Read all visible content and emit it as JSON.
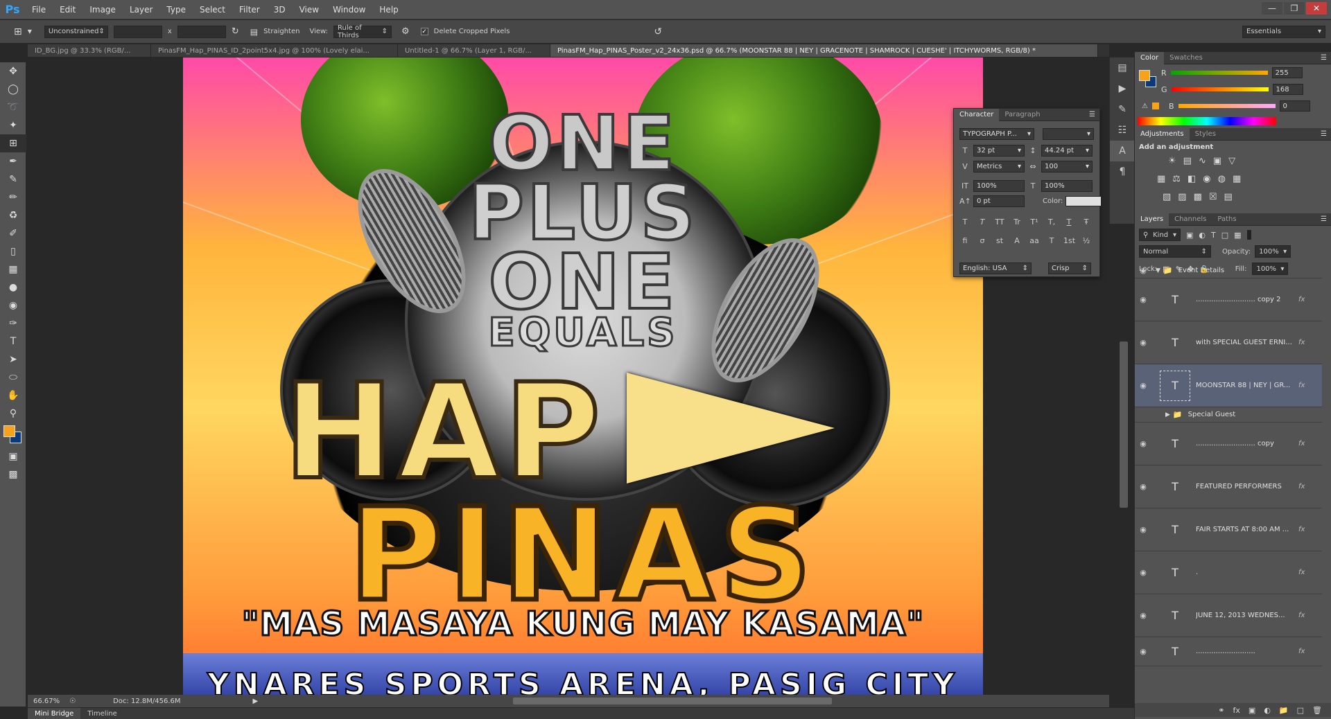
{
  "app": {
    "logo": "Ps",
    "menu": [
      "File",
      "Edit",
      "Image",
      "Layer",
      "Type",
      "Select",
      "Filter",
      "3D",
      "View",
      "Window",
      "Help"
    ]
  },
  "options": {
    "ratio": "Unconstrained",
    "x_sep": "x",
    "straighten": "Straighten",
    "view_label": "View:",
    "view_value": "Rule of Thirds",
    "delete_cropped": "Delete Cropped Pixels",
    "workspace": "Essentials"
  },
  "tabs": [
    "ID_BG.jpg @ 33.3% (RGB/...",
    "PinasFM_Hap_PINAS_ID_2point5x4.jpg @ 100% (Lovely elai...",
    "Untitled-1 @ 66.7% (Layer 1, RGB/...",
    "PinasFM_Hap_PINAS_Poster_v2_24x36.psd @ 66.7% (MOONSTAR 88 | NEY | GRACENOTE | SHAMROCK | CUESHE' | ITCHYWORMS, RGB/8) *"
  ],
  "poster": {
    "line1": "ONE",
    "line2": "PLUS",
    "line3": "ONE",
    "line4": "EQUALS",
    "hap": "HAP",
    "pinas": "PINAS",
    "tagline": "\"MAS MASAYA KUNG MAY KASAMA\"",
    "venue": "YNARES SPORTS ARENA, PASIG CITY"
  },
  "status": {
    "zoom": "66.67%",
    "doc": "Doc: 12.8M/456.6M"
  },
  "bottom_tabs": [
    "Mini Bridge",
    "Timeline"
  ],
  "character": {
    "tabs": [
      "Character",
      "Paragraph"
    ],
    "font": "TYPOGRAPH P...",
    "size": "32 pt",
    "leading": "44.24 pt",
    "kerning": "Metrics",
    "tracking": "100",
    "vscale": "100%",
    "hscale": "100%",
    "baseline": "0 pt",
    "color_label": "Color:",
    "style_buttons": [
      "T",
      "T",
      "TT",
      "Tr",
      "T¹",
      "T,",
      "T",
      "Ŧ"
    ],
    "language": "English: USA",
    "antialias": "Crisp"
  },
  "color_panel": {
    "tabs": [
      "Color",
      "Swatches"
    ],
    "r_label": "R",
    "g_label": "G",
    "b_label": "B",
    "r": "255",
    "g": "168",
    "b": "0",
    "fg": "#f7a21b",
    "bg": "#0a3a7a"
  },
  "adjustments": {
    "tabs": [
      "Adjustments",
      "Styles"
    ],
    "title": "Add an adjustment"
  },
  "layers": {
    "tabs": [
      "Layers",
      "Channels",
      "Paths"
    ],
    "kind": "Kind",
    "blend": "Normal",
    "opacity_label": "Opacity:",
    "opacity": "100%",
    "lock_label": "Lock:",
    "fill_label": "Fill:",
    "fill": "100%",
    "group": "Event Details",
    "items": [
      {
        "name": "........................... copy 2",
        "fx": "fx"
      },
      {
        "name": "with SPECIAL GUEST ERNI...",
        "fx": "fx"
      },
      {
        "name": "MOONSTAR 88 | NEY | GR...",
        "fx": "fx"
      },
      {
        "name": "Special Guest",
        "fx": ""
      },
      {
        "name": "........................... copy",
        "fx": "fx"
      },
      {
        "name": "FEATURED PERFORMERS",
        "fx": "fx"
      },
      {
        "name": "FAIR STARTS AT 8:00 AM ...",
        "fx": "fx"
      },
      {
        "name": ".",
        "fx": "fx"
      },
      {
        "name": "JUNE 12, 2013   WEDNES...",
        "fx": "fx"
      },
      {
        "name": "...........................",
        "fx": "fx"
      }
    ]
  }
}
